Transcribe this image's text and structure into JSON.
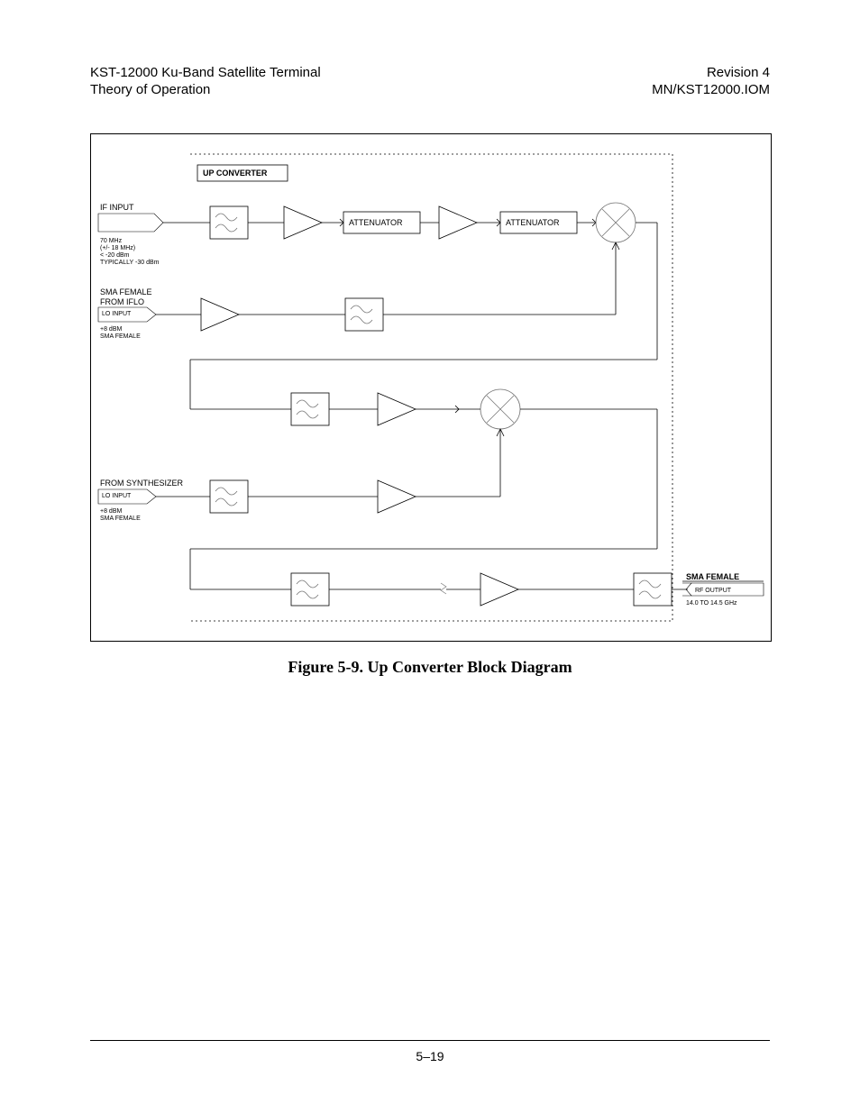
{
  "header": {
    "left_line1": "KST-12000 Ku-Band Satellite Terminal",
    "left_line2": "Theory of Operation",
    "right_line1": "Revision 4",
    "right_line2": "MN/KST12000.IOM"
  },
  "diagram": {
    "title": "UP CONVERTER",
    "if_input": {
      "label": "IF INPUT",
      "spec1": "70 MHz",
      "spec2": "(+/- 18 MHz)",
      "spec3": "< -20 dBm",
      "spec4": "TYPICALLY -30 dBm"
    },
    "iflo": {
      "label1": "SMA FEMALE",
      "label2": "FROM IFLO",
      "port": "LO INPUT",
      "spec1": "+8 dBM",
      "spec2": "SMA FEMALE"
    },
    "synth": {
      "label": "FROM SYNTHESIZER",
      "port": "LO INPUT",
      "spec1": "+8 dBM",
      "spec2": "SMA FEMALE"
    },
    "atten1": "ATTENUATOR",
    "atten2": "ATTENUATOR",
    "output": {
      "label": "SMA FEMALE",
      "port": "RF OUTPUT",
      "spec": "14.0 TO 14.5 GHz"
    }
  },
  "caption": "Figure 5-9.  Up Converter Block Diagram",
  "page_number": "5–19"
}
